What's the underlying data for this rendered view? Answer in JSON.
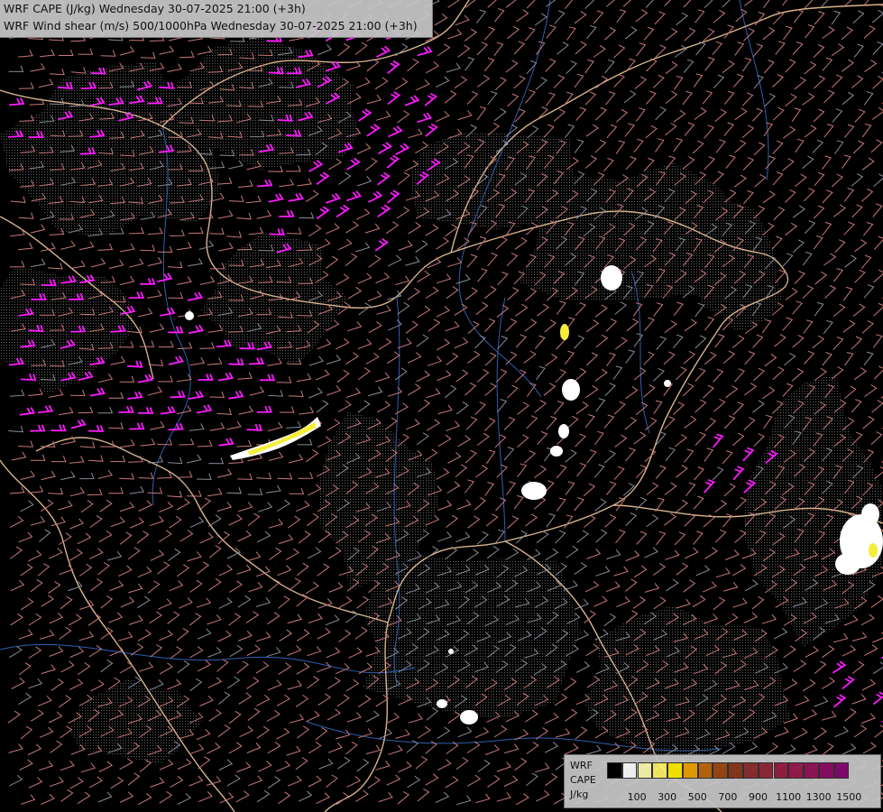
{
  "title": {
    "line1": "WRF CAPE (J/kg) Wednesday 30-07-2025 21:00 (+3h)",
    "line2": "WRF Wind shear (m/s) 500/1000hPa Wednesday 30-07-2025 21:00 (+3h)"
  },
  "legend": {
    "label_line1": "WRF",
    "label_line2": "CAPE",
    "label_line3": "J/kg",
    "ticks": [
      "100",
      "300",
      "500",
      "700",
      "900",
      "1100",
      "1300",
      "1500"
    ],
    "colors": [
      "#000000",
      "#ffffff",
      "#fffbb0",
      "#fff56a",
      "#ffee00",
      "#f0a400",
      "#c06a10",
      "#9c4a14",
      "#8a3a1c",
      "#8e3030",
      "#94283a",
      "#982044",
      "#9a1c50",
      "#96165c",
      "#900f68",
      "#860a72"
    ]
  },
  "colors": {
    "background": "#000000",
    "border_line": "#d8b48c",
    "river": "#2f5fb0",
    "shear_barb": "#c87878",
    "shear_barb_gray": "#8a8a98",
    "strong_shear_barb": "#ff1aff",
    "cape_white": "#ffffff",
    "cape_yellow": "#f5ee3a"
  }
}
